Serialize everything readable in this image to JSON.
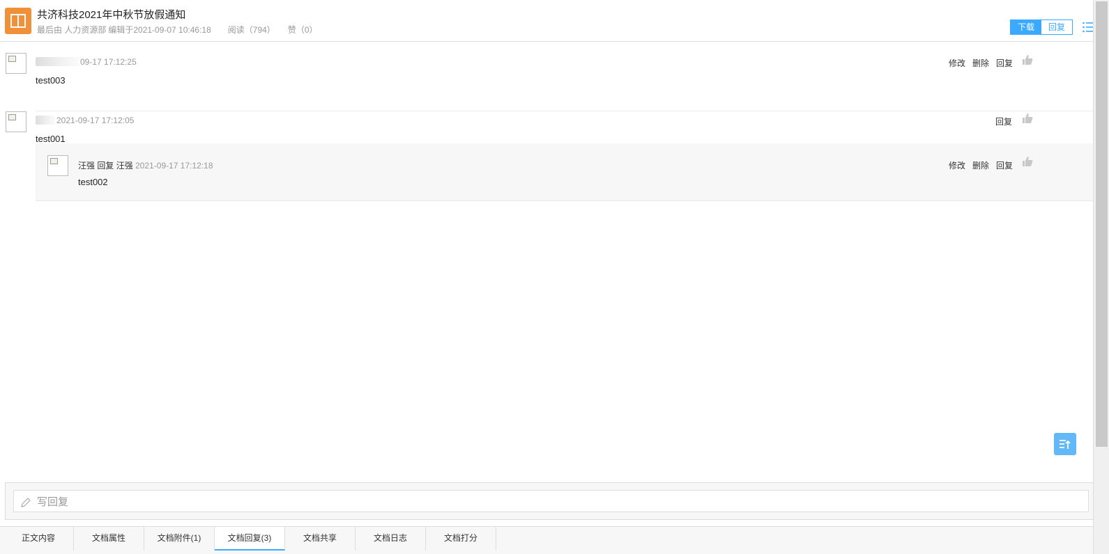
{
  "header": {
    "title": "共济科技2021年中秋节放假通知",
    "meta_editor": "最后由 人力资源部",
    "meta_edit_time": "编辑于2021-09-07 10:46:18",
    "meta_read": "阅读（794）",
    "meta_like": "赞（0）",
    "download_label": "下载",
    "reply_label": "回复"
  },
  "replies": [
    {
      "time": "09-17 17:12:25",
      "content": "test003",
      "actions": [
        "修改",
        "删除",
        "回复"
      ]
    },
    {
      "time": "2021-09-17 17:12:05",
      "content": "test001",
      "actions": [
        "回复"
      ],
      "children": [
        {
          "author": "汪强",
          "reply_word": "回复",
          "target": "汪强",
          "time": "2021-09-17 17:12:18",
          "content": "test002",
          "actions": [
            "修改",
            "删除",
            "回复"
          ]
        }
      ]
    }
  ],
  "compose": {
    "placeholder": "写回复"
  },
  "tabs": [
    "正文内容",
    "文档属性",
    "文档附件(1)",
    "文档回复(3)",
    "文档共享",
    "文档日志",
    "文档打分"
  ],
  "active_tab": 3,
  "colors": {
    "accent": "#3aa9ff",
    "doc_icon": "#f0913a",
    "to_top": "#63b8f7"
  }
}
